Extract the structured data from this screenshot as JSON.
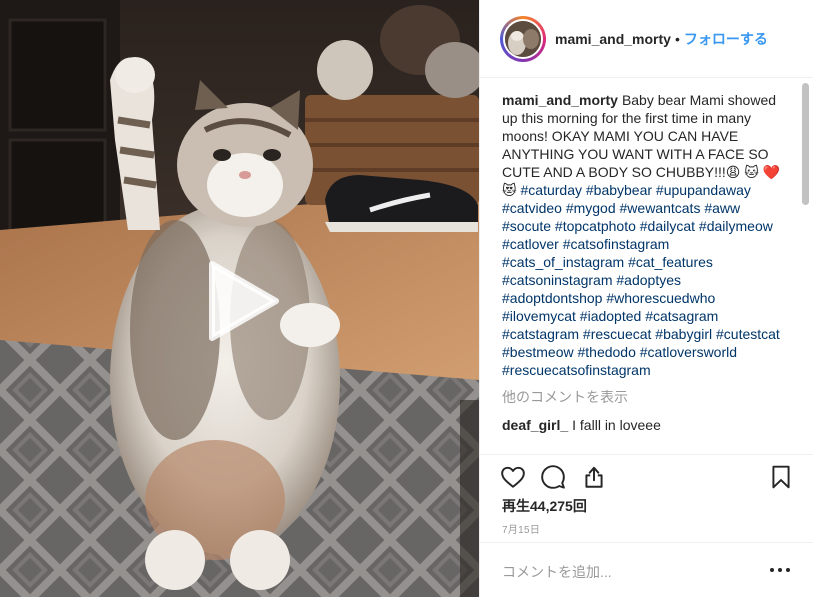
{
  "header": {
    "username": "mami_and_morty",
    "separator": "•",
    "follow_label": "フォローする"
  },
  "caption": {
    "username": "mami_and_morty",
    "text": "Baby bear Mami showed up this morning for the first time in many moons! OKAY MAMI YOU CAN HAVE ANYTHING YOU WANT WITH A FACE SO CUTE AND A BODY SO CHUBBY!!!😩 🐱 ❤️ 😻",
    "hashtags": "#caturday #babybear #upupandaway #catvideo #mygod #wewantcats #aww #socute #topcatphoto #dailycat #dailymeow #catlover #catsofinstagram #cats_of_instagram #cat_features #catsoninstagram #adoptyes #adoptdontshop #whorescuedwho #ilovemycat #iadopted #catsagram #catstagram #rescuecat #babygirl #cutestcat #bestmeow #thedodo #catloversworld #rescuecatsofinstagram"
  },
  "more_comments_label": "他のコメントを表示",
  "comments": [
    {
      "username": "deaf_girl_",
      "text": "I falll in loveee"
    }
  ],
  "views_label": "再生44,275回",
  "date_label": "7月15日",
  "add_comment_placeholder": "コメントを追加...",
  "more_options_label": "•••",
  "icons": {
    "like": "heart-icon",
    "comment": "comment-bubble-icon",
    "share": "share-icon",
    "save": "bookmark-icon",
    "play": "play-icon"
  },
  "colors": {
    "link_blue": "#3897f0",
    "hashtag_navy": "#003569",
    "muted_gray": "#999999",
    "text_dark": "#262626",
    "divider": "#efefef"
  }
}
